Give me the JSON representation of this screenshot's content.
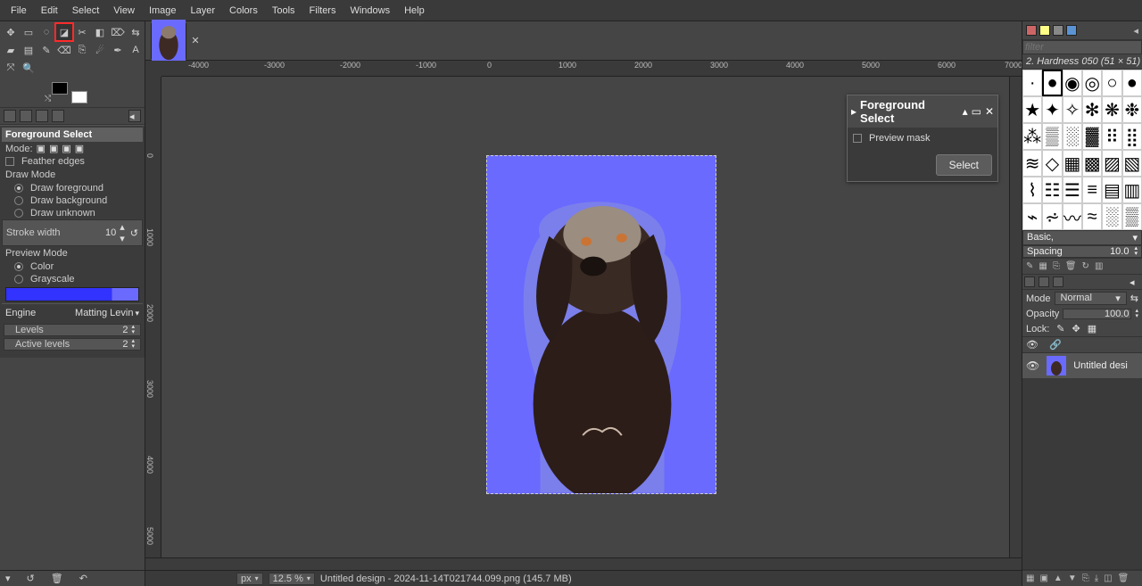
{
  "menu": {
    "items": [
      "File",
      "Edit",
      "Select",
      "View",
      "Image",
      "Layer",
      "Colors",
      "Tools",
      "Filters",
      "Windows",
      "Help"
    ]
  },
  "tool_options": {
    "title": "Foreground Select",
    "mode_label": "Mode:",
    "feather_label": "Feather edges",
    "draw_mode_label": "Draw Mode",
    "draw_fore": "Draw foreground",
    "draw_back": "Draw background",
    "draw_unk": "Draw unknown",
    "stroke_label": "Stroke width",
    "stroke_value": "10",
    "preview_mode_label": "Preview Mode",
    "preview_color": "Color",
    "preview_gray": "Grayscale",
    "engine_label": "Engine",
    "engine_value": "Matting Levin",
    "levels_label": "Levels",
    "levels_value": "2",
    "active_levels_label": "Active levels",
    "active_levels_value": "2"
  },
  "fg_dialog": {
    "title": "Foreground Select",
    "preview_mask": "Preview mask",
    "select_btn": "Select"
  },
  "statusbar": {
    "unit": "px",
    "zoom": "12.5 %",
    "filename": "Untitled design - 2024-11-14T021744.099.png (145.7 MB)"
  },
  "right": {
    "filter_placeholder": "filter",
    "brush_title": "2. Hardness 050 (51 × 51)",
    "dyn": "Basic,",
    "spacing_label": "Spacing",
    "spacing_value": "10.0",
    "mode_label": "Mode",
    "mode_value": "Normal",
    "opacity_label": "Opacity",
    "opacity_value": "100.0",
    "lock_label": "Lock:",
    "layer_name": "Untitled desi"
  },
  "ruler_h": [
    "-4000",
    "-3000",
    "-2000",
    "-1000",
    "0",
    "1000",
    "2000",
    "3000",
    "4000",
    "5000",
    "6000",
    "7000"
  ],
  "ruler_v": [
    "0",
    "1000",
    "2000",
    "3000",
    "4000",
    "5000"
  ]
}
